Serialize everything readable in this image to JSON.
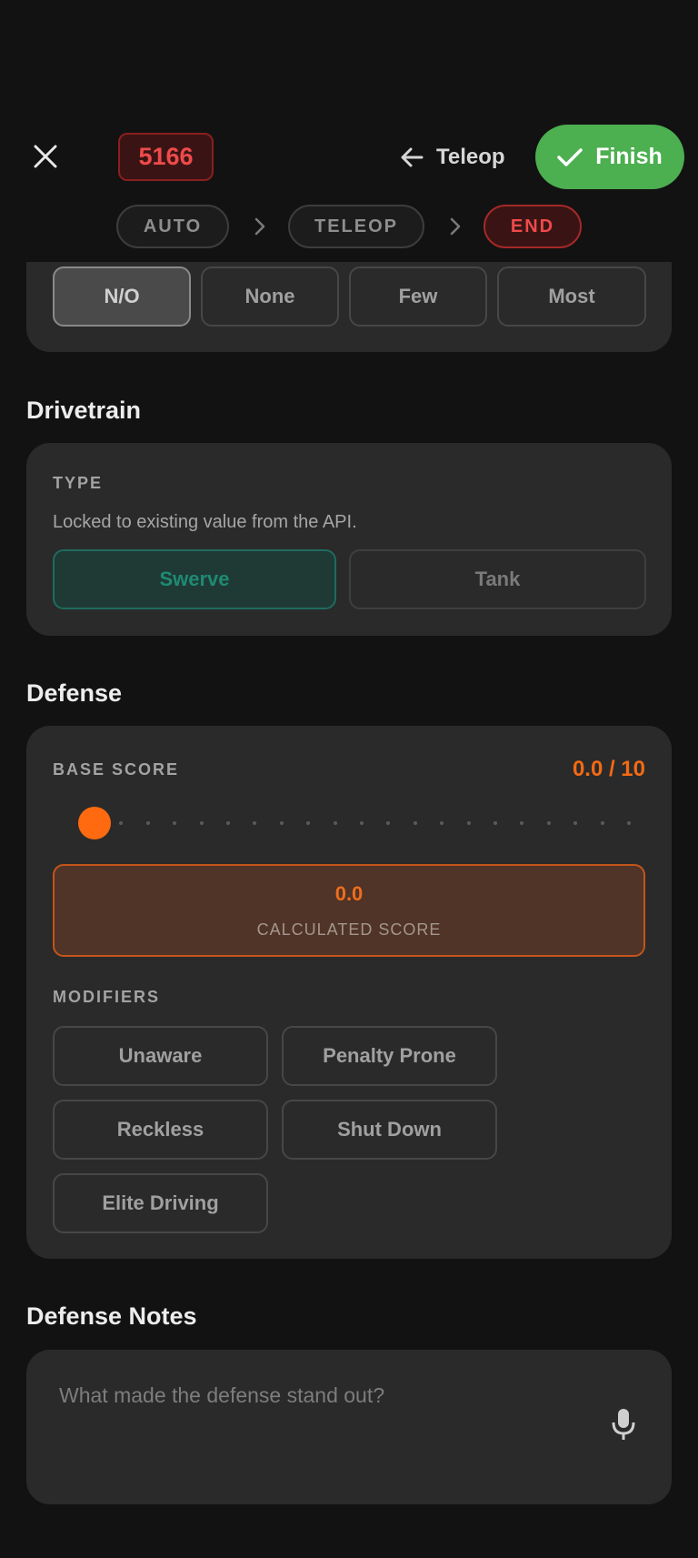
{
  "header": {
    "team_number": "5166",
    "back_label": "Teleop",
    "finish_label": "Finish"
  },
  "phases": [
    {
      "label": "AUTO",
      "active": false
    },
    {
      "label": "TELEOP",
      "active": false
    },
    {
      "label": "END",
      "active": true
    }
  ],
  "top_options": {
    "items": [
      "N/O",
      "None",
      "Few",
      "Most"
    ],
    "selected": "N/O"
  },
  "drivetrain": {
    "title": "Drivetrain",
    "type_label": "TYPE",
    "locked_note": "Locked to existing value from the API.",
    "options": [
      "Swerve",
      "Tank"
    ],
    "selected": "Swerve"
  },
  "defense": {
    "title": "Defense",
    "base_score_label": "BASE SCORE",
    "base_score_display": "0.0 / 10",
    "base_score_value": 0.0,
    "base_score_max": 10,
    "calculated_score": "0.0",
    "calculated_label": "CALCULATED SCORE",
    "modifiers_label": "MODIFIERS",
    "modifiers": [
      "Unaware",
      "Penalty Prone",
      "Reckless",
      "Shut Down",
      "Elite Driving"
    ]
  },
  "defense_notes": {
    "title": "Defense Notes",
    "placeholder": "What made the defense stand out?",
    "value": ""
  },
  "colors": {
    "accent_orange": "#f26a14",
    "finish_green": "#4caf50",
    "team_red": "#ef4a4a",
    "swerve_teal": "#1f8a74"
  },
  "icons": [
    "close-icon",
    "arrow-left-icon",
    "check-icon",
    "chevron-right-icon",
    "microphone-icon"
  ]
}
